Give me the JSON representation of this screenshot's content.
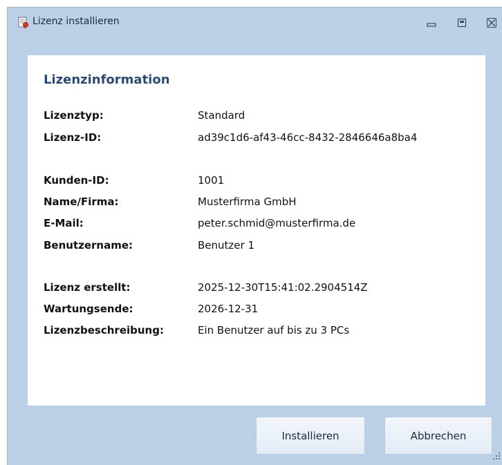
{
  "window": {
    "title": "Lizenz installieren",
    "controls": {
      "minimize": "minimize-icon",
      "maximize": "maximize-icon",
      "close": "close-icon"
    }
  },
  "license": {
    "heading": "Lizenzinformation",
    "rows": [
      {
        "label": "Lizenztyp:",
        "value": "Standard"
      },
      {
        "label": "Lizenz-ID:",
        "value": "ad39c1d6-af43-46cc-8432-2846646a8ba4"
      },
      {
        "label": "Kunden-ID:",
        "value": "1001"
      },
      {
        "label": "Name/Firma:",
        "value": "Musterfirma GmbH"
      },
      {
        "label": "E-Mail:",
        "value": "peter.schmid@musterfirma.de"
      },
      {
        "label": "Benutzername:",
        "value": "Benutzer 1"
      },
      {
        "label": "Lizenz erstellt:",
        "value": "2025-12-30T15:41:02.2904514Z"
      },
      {
        "label": "Wartungsende:",
        "value": "2026-12-31"
      },
      {
        "label": "Lizenzbeschreibung:",
        "value": "Ein Benutzer auf bis zu 3 PCs"
      }
    ]
  },
  "buttons": {
    "install": "Installieren",
    "cancel": "Abbrechen"
  },
  "colors": {
    "window_background": "#bcd0e8",
    "panel_background": "#ffffff",
    "heading": "#2d4a72"
  }
}
